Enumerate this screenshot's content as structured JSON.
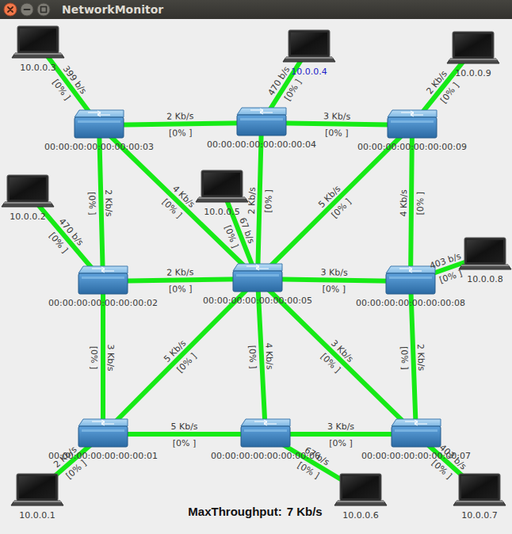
{
  "window": {
    "title": "NetworkMonitor"
  },
  "switches": [
    {
      "label": "00:00:00:00:00:00:00:03"
    },
    {
      "label": "00:00:00:00:00:00:00:04"
    },
    {
      "label": "00:00:00:00:00:00:00:09"
    },
    {
      "label": "00:00:00:00:00:00:00:02"
    },
    {
      "label": "00:00:00:00:00:00:00:05"
    },
    {
      "label": "00:00:00:00:00:00:00:08"
    },
    {
      "label": "00:00:00:00:00:00:00:01"
    },
    {
      "label": "00:00:00:00:00:00:00:06"
    },
    {
      "label": "00:00:00:00:00:00:00:07"
    }
  ],
  "hosts": [
    {
      "label": "10.0.0.3",
      "selected": false
    },
    {
      "label": "10.0.0.4",
      "selected": true
    },
    {
      "label": "10.0.0.9",
      "selected": false
    },
    {
      "label": "10.0.0.2",
      "selected": false
    },
    {
      "label": "10.0.0.5",
      "selected": false
    },
    {
      "label": "10.0.0.8",
      "selected": false
    },
    {
      "label": "10.0.0.1",
      "selected": false
    },
    {
      "label": "10.0.0.6",
      "selected": false
    },
    {
      "label": "10.0.0.7",
      "selected": false
    }
  ],
  "links": [
    {
      "from": "10.0.0.3",
      "to": "00:00:00:00:00:00:00:03",
      "rate": "399 b/s",
      "utilization": "[0% ]"
    },
    {
      "from": "10.0.0.4",
      "to": "00:00:00:00:00:00:00:04",
      "rate": "470 b/s",
      "utilization": "[0% ]"
    },
    {
      "from": "10.0.0.9",
      "to": "00:00:00:00:00:00:00:09",
      "rate": "2 Kb/s",
      "utilization": "[0% ]"
    },
    {
      "from": "00:00:00:00:00:00:00:03",
      "to": "00:00:00:00:00:00:00:04",
      "rate": "2 Kb/s",
      "utilization": "[0% ]"
    },
    {
      "from": "00:00:00:00:00:00:00:04",
      "to": "00:00:00:00:00:00:00:09",
      "rate": "3 Kb/s",
      "utilization": "[0% ]"
    },
    {
      "from": "00:00:00:00:00:00:00:03",
      "to": "00:00:00:00:00:00:00:02",
      "rate": "2 Kb/s",
      "utilization": "[0% ]"
    },
    {
      "from": "00:00:00:00:00:00:00:03",
      "to": "00:00:00:00:00:00:00:05",
      "rate": "4 Kb/s",
      "utilization": "[0% ]"
    },
    {
      "from": "00:00:00:00:00:00:00:04",
      "to": "00:00:00:00:00:00:00:05",
      "rate": "2 Kb/s",
      "utilization": "[0% ]"
    },
    {
      "from": "00:00:00:00:00:00:00:09",
      "to": "00:00:00:00:00:00:00:05",
      "rate": "5 Kb/s",
      "utilization": "[0% ]"
    },
    {
      "from": "00:00:00:00:00:00:00:09",
      "to": "00:00:00:00:00:00:00:08",
      "rate": "4 Kb/s",
      "utilization": "[0% ]"
    },
    {
      "from": "10.0.0.2",
      "to": "00:00:00:00:00:00:00:02",
      "rate": "470 b/s",
      "utilization": "[0% ]"
    },
    {
      "from": "10.0.0.5",
      "to": "00:00:00:00:00:00:00:05",
      "rate": "67 b/s",
      "utilization": "[0% ]"
    },
    {
      "from": "00:00:00:00:00:00:00:02",
      "to": "00:00:00:00:00:00:00:05",
      "rate": "2 Kb/s",
      "utilization": "[0% ]"
    },
    {
      "from": "00:00:00:00:00:00:00:05",
      "to": "00:00:00:00:00:00:00:08",
      "rate": "3 Kb/s",
      "utilization": "[0% ]"
    },
    {
      "from": "10.0.0.8",
      "to": "00:00:00:00:00:00:00:08",
      "rate": "403 b/s",
      "utilization": "[0% ]"
    },
    {
      "from": "00:00:00:00:00:00:00:02",
      "to": "00:00:00:00:00:00:00:01",
      "rate": "3 Kb/s",
      "utilization": "[0% ]"
    },
    {
      "from": "00:00:00:00:00:00:00:05",
      "to": "00:00:00:00:00:00:00:01",
      "rate": "5 Kb/s",
      "utilization": "[0% ]"
    },
    {
      "from": "00:00:00:00:00:00:00:05",
      "to": "00:00:00:00:00:00:00:06",
      "rate": "4 Kb/s",
      "utilization": "[0% ]"
    },
    {
      "from": "00:00:00:00:00:00:00:05",
      "to": "00:00:00:00:00:00:00:07",
      "rate": "3 Kb/s",
      "utilization": "[0% ]"
    },
    {
      "from": "00:00:00:00:00:00:00:08",
      "to": "00:00:00:00:00:00:00:07",
      "rate": "2 Kb/s",
      "utilization": "[0% ]"
    },
    {
      "from": "00:00:00:00:00:00:00:01",
      "to": "00:00:00:00:00:00:00:06",
      "rate": "5 Kb/s",
      "utilization": "[0% ]"
    },
    {
      "from": "00:00:00:00:00:00:00:06",
      "to": "00:00:00:00:00:00:00:07",
      "rate": "3 Kb/s",
      "utilization": "[0% ]"
    },
    {
      "from": "10.0.0.1",
      "to": "00:00:00:00:00:00:00:01",
      "rate": "2 Kb/s",
      "utilization": "[0% ]"
    },
    {
      "from": "10.0.0.6",
      "to": "00:00:00:00:00:00:00:06",
      "rate": "67 b/s",
      "utilization": "[0% ]"
    },
    {
      "from": "10.0.0.7",
      "to": "00:00:00:00:00:00:00:07",
      "rate": "403 b/s",
      "utilization": "[0% ]"
    }
  ],
  "max_throughput": {
    "label": "MaxThroughput:",
    "value": "7 Kb/s"
  }
}
